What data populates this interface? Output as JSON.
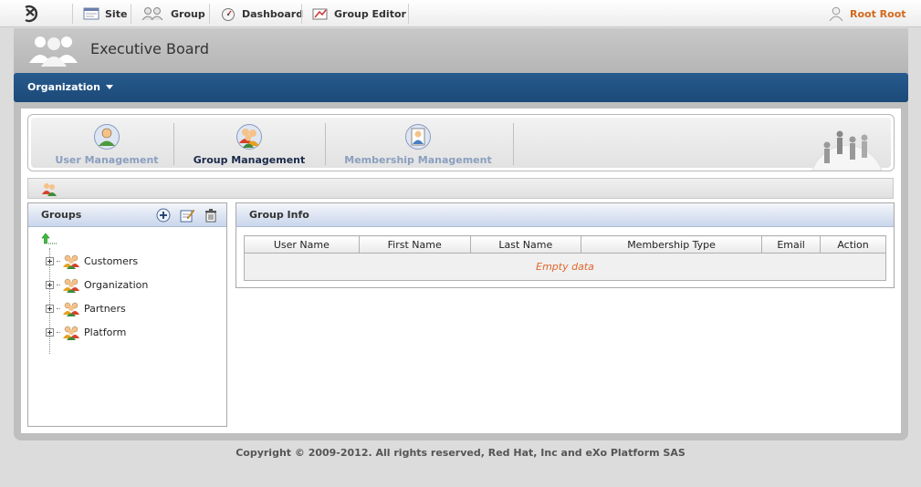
{
  "toolbar": {
    "items": [
      {
        "label": "Site",
        "icon": "site-icon"
      },
      {
        "label": "Group",
        "icon": "group-icon"
      },
      {
        "label": "Dashboard",
        "icon": "dashboard-icon"
      },
      {
        "label": "Group Editor",
        "icon": "group-editor-icon"
      }
    ],
    "user": {
      "label": "Root Root",
      "icon": "user-icon",
      "color": "#d2691e"
    }
  },
  "portal": {
    "title": "Executive Board"
  },
  "navbar": {
    "menu_label": "Organization"
  },
  "tabs": [
    {
      "label": "User Management",
      "active": false
    },
    {
      "label": "Group Management",
      "active": true
    },
    {
      "label": "Membership Management",
      "active": false
    }
  ],
  "groups_panel": {
    "title": "Groups",
    "nodes": [
      "Customers",
      "Organization",
      "Partners",
      "Platform"
    ]
  },
  "group_info": {
    "title": "Group Info",
    "columns": [
      "User Name",
      "First Name",
      "Last Name",
      "Membership Type",
      "Email",
      "Action"
    ],
    "empty_text": "Empty data"
  },
  "footer": {
    "text": "Copyright © 2009-2012. All rights reserved, Red Hat, Inc and eXo Platform SAS"
  },
  "colors": {
    "navbar": "#1c4a78",
    "empty_text": "#e0652a",
    "user_link": "#d2691e"
  }
}
